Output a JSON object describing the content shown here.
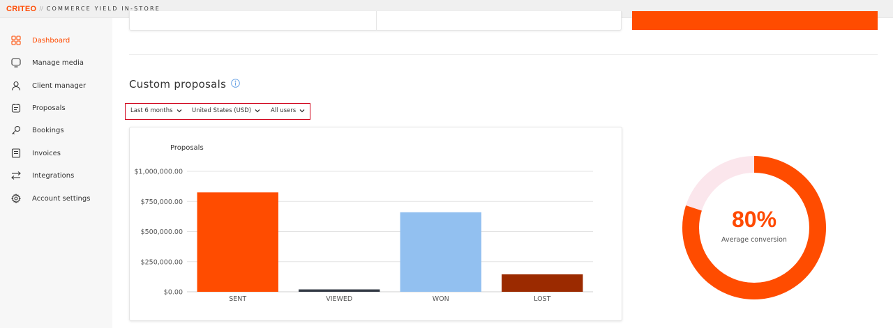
{
  "header": {
    "brand": "CRITEO",
    "separator": "//",
    "product": "COMMERCE YIELD IN-STORE"
  },
  "sidebar": {
    "items": [
      {
        "label": "Dashboard",
        "icon": "dashboard-grid-icon",
        "active": true
      },
      {
        "label": "Manage media",
        "icon": "monitor-icon",
        "active": false
      },
      {
        "label": "Client manager",
        "icon": "user-icon",
        "active": false
      },
      {
        "label": "Proposals",
        "icon": "proposal-icon",
        "active": false
      },
      {
        "label": "Bookings",
        "icon": "key-icon",
        "active": false
      },
      {
        "label": "Invoices",
        "icon": "invoice-icon",
        "active": false
      },
      {
        "label": "Integrations",
        "icon": "swap-arrows-icon",
        "active": false
      },
      {
        "label": "Account settings",
        "icon": "gear-icon",
        "active": false
      }
    ]
  },
  "section": {
    "title": "Custom proposals",
    "info_icon": "info-icon"
  },
  "filters": {
    "period": "Last 6 months",
    "country": "United States (USD)",
    "users": "All users"
  },
  "chart_data": {
    "type": "bar",
    "title": "Proposals",
    "categories": [
      "SENT",
      "VIEWED",
      "WON",
      "LOST"
    ],
    "values": [
      825000,
      20000,
      660000,
      145000
    ],
    "colors": [
      "#ff4c00",
      "#333a45",
      "#92c0f0",
      "#9b2a00"
    ],
    "ylim": [
      0,
      1000000
    ],
    "yticks": [
      0,
      250000,
      500000,
      750000,
      1000000
    ],
    "ytick_labels": [
      "$0.00",
      "$250,000.00",
      "$500,000.00",
      "$750,000.00",
      "$1,000,000.00"
    ],
    "grid": true
  },
  "conversion": {
    "value_label": "80%",
    "fraction": 0.8,
    "subtitle": "Average conversion",
    "color_filled": "#ff4c00",
    "color_empty": "#fbe6ec"
  },
  "colors": {
    "accent": "#ff4a00",
    "filter_border": "#d0021b"
  }
}
